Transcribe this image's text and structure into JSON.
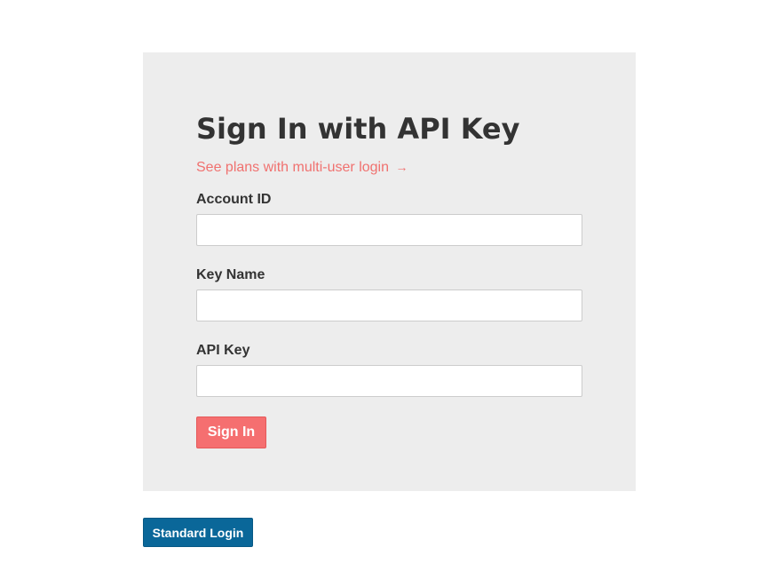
{
  "signin_card": {
    "title": "Sign In with API Key",
    "plans_link": {
      "label": "See plans with multi-user login",
      "arrow": "→"
    },
    "fields": [
      {
        "label": "Account ID",
        "value": "",
        "placeholder": ""
      },
      {
        "label": "Key Name",
        "value": "",
        "placeholder": ""
      },
      {
        "label": "API Key",
        "value": "",
        "placeholder": ""
      }
    ],
    "submit_label": "Sign In"
  },
  "standard_login_label": "Standard Login",
  "colors": {
    "card_background": "#ededed",
    "accent": "#f56f70",
    "link": "#f0716f",
    "primary_button": "#0a6799",
    "heading_text": "#333333"
  }
}
